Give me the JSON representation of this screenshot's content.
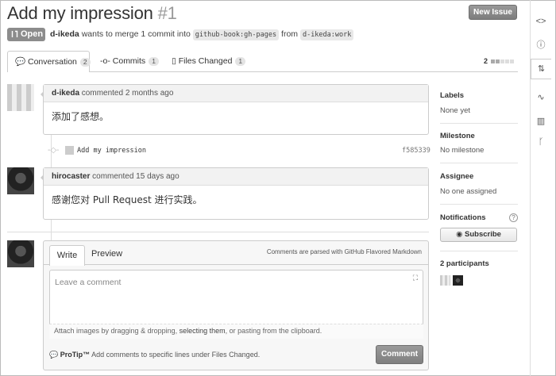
{
  "header": {
    "title": "Add my impression",
    "number": "#1",
    "new_issue_label": "New Issue",
    "state": "Open",
    "author": "d-ikeda",
    "merge_text": "wants to merge 1 commit into",
    "base_branch": "github-book:gh-pages",
    "from_text": "from",
    "head_branch": "d-ikeda:work"
  },
  "tabs": [
    {
      "label": "Conversation",
      "count": "2"
    },
    {
      "label": "Commits",
      "count": "1"
    },
    {
      "label": "Files Changed",
      "count": "1"
    }
  ],
  "diffstat": "2",
  "comments": [
    {
      "author": "d-ikeda",
      "action": "commented 2 months ago",
      "body": "添加了感想。"
    },
    {
      "author": "hirocaster",
      "action": "commented 15 days ago",
      "body": "感谢您对 Pull Request 进行实践。"
    }
  ],
  "commit": {
    "message": "Add my impression",
    "sha": "f585339"
  },
  "editor": {
    "tab_write": "Write",
    "tab_preview": "Preview",
    "markdown_note": "Comments are parsed with GitHub Flavored Markdown",
    "placeholder": "Leave a comment",
    "attach_pre": "Attach images by dragging & dropping,",
    "attach_link": "selecting them",
    "attach_post": ", or pasting from the clipboard.",
    "protip_label": "ProTip™",
    "protip_text": "Add comments to specific lines under Files Changed.",
    "comment_button": "Comment"
  },
  "sidebar": {
    "labels_title": "Labels",
    "labels_value": "None yet",
    "milestone_title": "Milestone",
    "milestone_value": "No milestone",
    "assignee_title": "Assignee",
    "assignee_value": "No one assigned",
    "notifications_title": "Notifications",
    "subscribe_label": "Subscribe",
    "participants_title": "2 participants"
  },
  "icons": {
    "code": "code-icon",
    "issues": "issue-icon",
    "pull_requests": "pull-request-icon",
    "pulse": "pulse-icon",
    "graphs": "graph-icon",
    "network": "branch-icon"
  }
}
